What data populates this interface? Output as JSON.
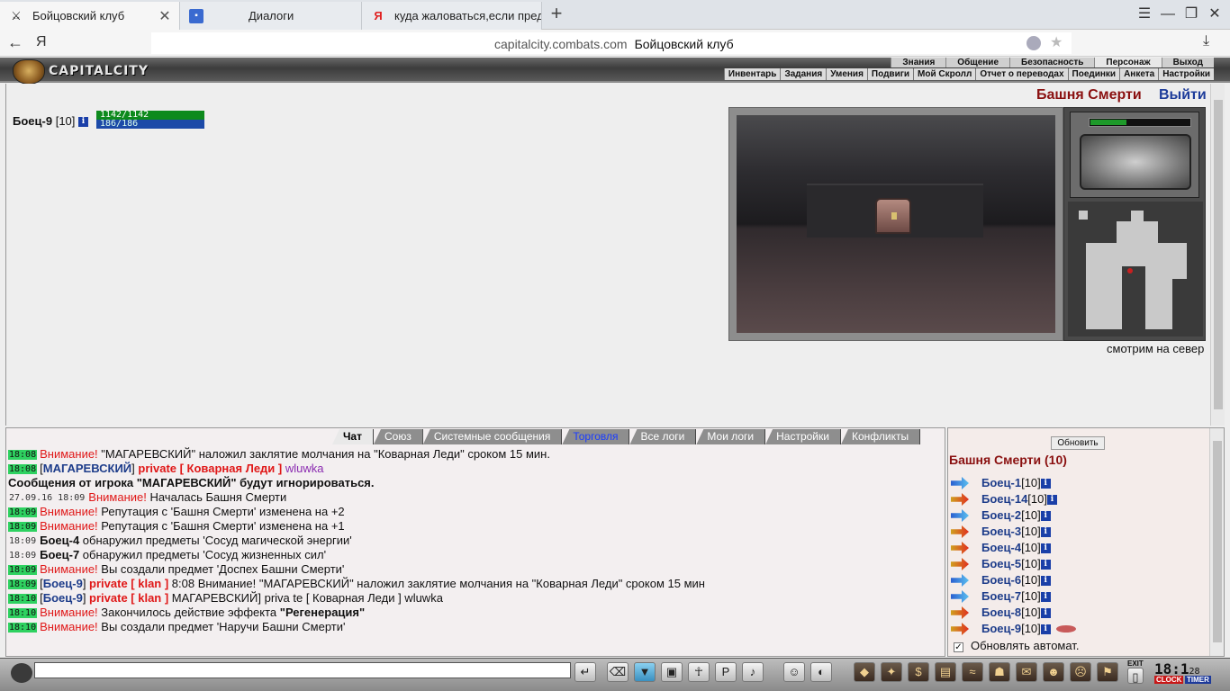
{
  "browser": {
    "tabs": [
      {
        "label": "Бойцовский клуб",
        "icon": "crossed-swords-icon",
        "active": true
      },
      {
        "label": "Диалоги",
        "icon": "chat-icon",
        "active": false
      },
      {
        "label": "куда жаловаться,если пред",
        "icon": "yandex-icon",
        "active": false
      }
    ],
    "new_tab": "+",
    "url": "capitalcity.combats.com",
    "page_title": "Бойцовский клуб",
    "yandex_logo": "Я"
  },
  "game_header": {
    "logo": "CAPITALCITY",
    "top_menu": [
      "Знания",
      "Общение",
      "Безопасность",
      "Персонаж",
      "Выход"
    ],
    "sub_menu": [
      "Инвентарь",
      "Задания",
      "Умения",
      "Подвиги",
      "Мой Скролл",
      "Отчет о переводах",
      "Поединки",
      "Анкета",
      "Настройки"
    ]
  },
  "player": {
    "name": "Боец-9",
    "level": "[10]",
    "info": "i",
    "hp": "1142/1142",
    "mana": "186/186",
    "hp_fraction": 1.0,
    "mana_fraction": 1.0
  },
  "location": {
    "title": "Башня Смерти",
    "exit": "Выйти",
    "direction": "смотрим на север"
  },
  "chat_tabs": [
    "Чат",
    "Союз",
    "Системные сообщения",
    "Торговля",
    "Все логи",
    "Мои логи",
    "Настройки",
    "Конфликты"
  ],
  "chat_lines": [
    {
      "time": "18:08",
      "warn": "Внимание!",
      "text": " \"МАГАРЕВСКИЙ\" наложил заклятие молчания на \"Коварная Леди\" сроком 15 мин."
    },
    {
      "time": "18:08",
      "nick": "МАГАРЕВСКИЙ",
      "priv": "private [ Коварная Леди ]",
      "text": " wluwka"
    },
    {
      "time": "",
      "bold": "Сообщения от игрока \"МАГАРЕВСКИЙ\" будут игнорироваться."
    },
    {
      "time": "27.09.16 18:09",
      "plain_time": true,
      "warn": "Внимание!",
      "text": " Началась Башня Смерти"
    },
    {
      "time": "18:09",
      "warn": "Внимание!",
      "text": " Репутация с 'Башня Смерти' изменена на +2"
    },
    {
      "time": "18:09",
      "warn": "Внимание!",
      "text": " Репутация с 'Башня Смерти' изменена на +1"
    },
    {
      "time": "18:09",
      "plain_time": true,
      "boldname": "Боец-4",
      "text": " обнаружил предметы 'Сосуд магической энергии'"
    },
    {
      "time": "18:09",
      "plain_time": true,
      "boldname": "Боец-7",
      "text": " обнаружил предметы 'Сосуд жизненных сил'"
    },
    {
      "time": "18:09",
      "warn": "Внимание!",
      "text": " Вы создали предмет 'Доспех Башни Смерти'"
    },
    {
      "time": "18:09",
      "nick": "Боец-9",
      "priv": "private [ klan ]",
      "text": " 8:08 Внимание! \"МАГАРЕВСКИЙ\" наложил заклятие молчания на \"Коварная Леди\" сроком 15 мин"
    },
    {
      "time": "18:10",
      "nick": "Боец-9",
      "priv": "private [ klan ]",
      "text": " МАГАРЕВСКИЙ] priva te [ Коварная Леди ] wluwka"
    },
    {
      "time": "18:10",
      "warn": "Внимание!",
      "text": " Закончилось действие эффекта ",
      "bold_tail": "\"Регенерация\""
    },
    {
      "time": "18:10",
      "warn": "Внимание!",
      "text": " Вы создали предмет 'Наручи Башни Смерти'"
    }
  ],
  "right_panel": {
    "refresh": "Обновить",
    "title": "Башня Смерти (10)",
    "fighters": [
      {
        "name": "Боец-1",
        "level": "[10]",
        "icon": "a"
      },
      {
        "name": "Боец-14",
        "level": "[10]",
        "icon": "b"
      },
      {
        "name": "Боец-2",
        "level": "[10]",
        "icon": "a"
      },
      {
        "name": "Боец-3",
        "level": "[10]",
        "icon": "b"
      },
      {
        "name": "Боец-4",
        "level": "[10]",
        "icon": "b"
      },
      {
        "name": "Боец-5",
        "level": "[10]",
        "icon": "b"
      },
      {
        "name": "Боец-6",
        "level": "[10]",
        "icon": "a"
      },
      {
        "name": "Боец-7",
        "level": "[10]",
        "icon": "a"
      },
      {
        "name": "Боец-8",
        "level": "[10]",
        "icon": "b"
      },
      {
        "name": "Боец-9",
        "level": "[10]",
        "icon": "b"
      }
    ],
    "auto_update": "Обновлять автомат.",
    "checkmark": "✓"
  },
  "toolbar": {
    "clock_time": "18:1",
    "clock_seconds": "28",
    "clock_label": "CLOCK",
    "timer_label": "TIMER",
    "exit_label": "EXIT"
  },
  "colors": {
    "accent_red": "#8a1010",
    "link_blue": "#1d3c9a",
    "timestamp_green": "#2ed160"
  }
}
